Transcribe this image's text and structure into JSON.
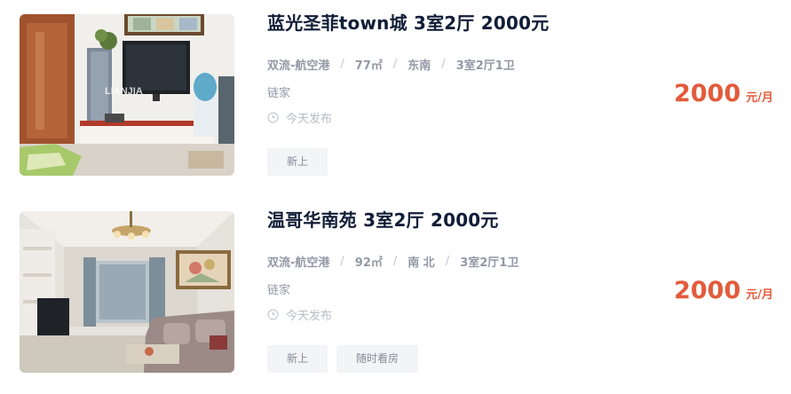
{
  "listings": [
    {
      "title": "蓝光圣菲town城 3室2厅 2000元",
      "location": "双流-航空港",
      "area": "77㎡",
      "orientation": "东南",
      "layout": "3室2厅1卫",
      "agency": "链家",
      "published": "今天发布",
      "tags": [
        "新上"
      ],
      "price": "2000",
      "price_unit": "元/月",
      "photo_watermark": "链家"
    },
    {
      "title": "温哥华南苑 3室2厅 2000元",
      "location": "双流-航空港",
      "area": "92㎡",
      "orientation": "南 北",
      "layout": "3室2厅1卫",
      "agency": "链家",
      "published": "今天发布",
      "tags": [
        "新上",
        "随时看房"
      ],
      "price": "2000",
      "price_unit": "元/月"
    }
  ],
  "colors": {
    "price": "#e35b3b",
    "title": "#101d37",
    "meta": "#9399a5",
    "tag_bg": "#f3f4f6"
  },
  "icons": {
    "time": "clock-icon"
  }
}
